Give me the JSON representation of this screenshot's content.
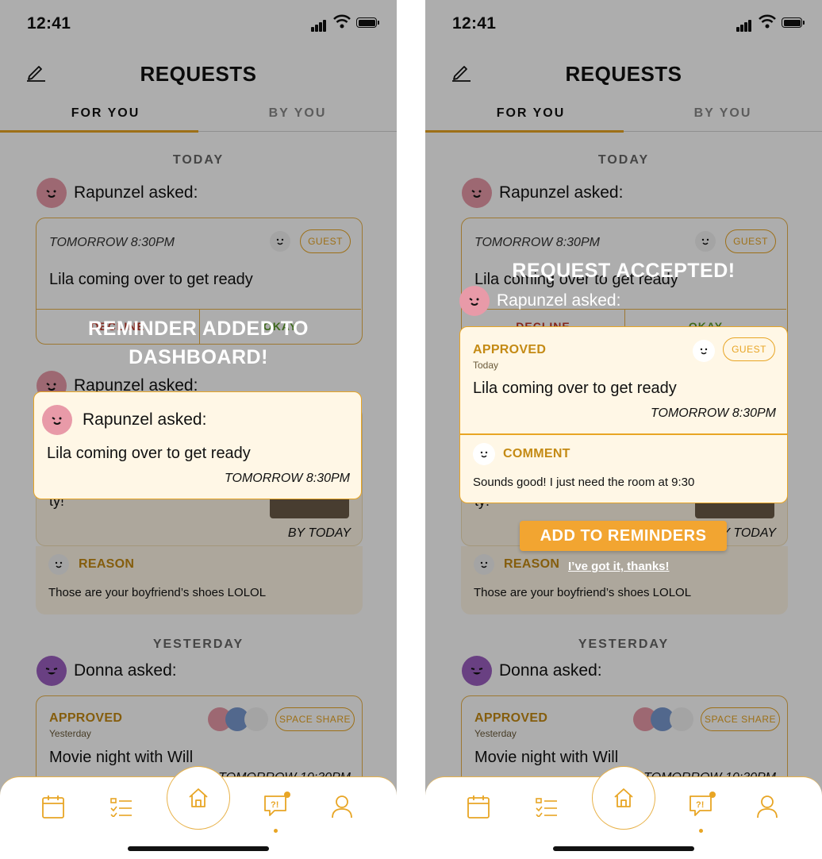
{
  "status": {
    "time": "12:41"
  },
  "header": {
    "title": "REQUESTS"
  },
  "tabs": {
    "for_you": "FOR YOU",
    "by_you": "BY YOU"
  },
  "sections": {
    "today": "TODAY",
    "yesterday": "YESTERDAY"
  },
  "requests": [
    {
      "asker": "Rapunzel asked:",
      "date": "TOMORROW 8:30PM",
      "tag": "GUEST",
      "description": "Lila coming over to get ready",
      "decline": "DECLINE",
      "okay": "OKAY"
    },
    {
      "asker": "Rapunzel asked:",
      "partial_text": "ty!",
      "deadline": "BY TODAY",
      "reason_label": "REASON",
      "reason_text": "Those are your boyfriend’s shoes LOLOL"
    },
    {
      "asker": "Donna asked:",
      "status": "APPROVED",
      "status_sub": "Yesterday",
      "tag": "SPACE SHARE",
      "description": "Movie night with Will",
      "date": "TOMORROW 10:30PM"
    }
  ],
  "left_overlay": {
    "message_line1": "REMINDER ADDED TO",
    "message_line2": "DASHBOARD!",
    "popup": {
      "asker": "Rapunzel asked:",
      "description": "Lila coming over to get ready",
      "date": "TOMORROW 8:30PM"
    }
  },
  "right_overlay": {
    "message": "REQUEST ACCEPTED!",
    "asker": "Rapunzel asked:",
    "popup": {
      "status": "APPROVED",
      "status_sub": "Today",
      "tag": "GUEST",
      "description": "Lila coming over to get ready",
      "date": "TOMORROW 8:30PM",
      "comment_label": "COMMENT",
      "comment_text": "Sounds good! I just need the room at 9:30"
    },
    "add_button": "ADD TO REMINDERS",
    "dismiss_link": "I’ve got it, thanks!"
  },
  "nav": {
    "items": [
      "calendar-icon",
      "checklist-icon",
      "home-icon",
      "requests-icon",
      "profile-icon"
    ],
    "badge_color": "#e8a524"
  },
  "colors": {
    "accent": "#e8a524",
    "approved": "#c48a14",
    "popup_bg": "#fff7e6"
  }
}
